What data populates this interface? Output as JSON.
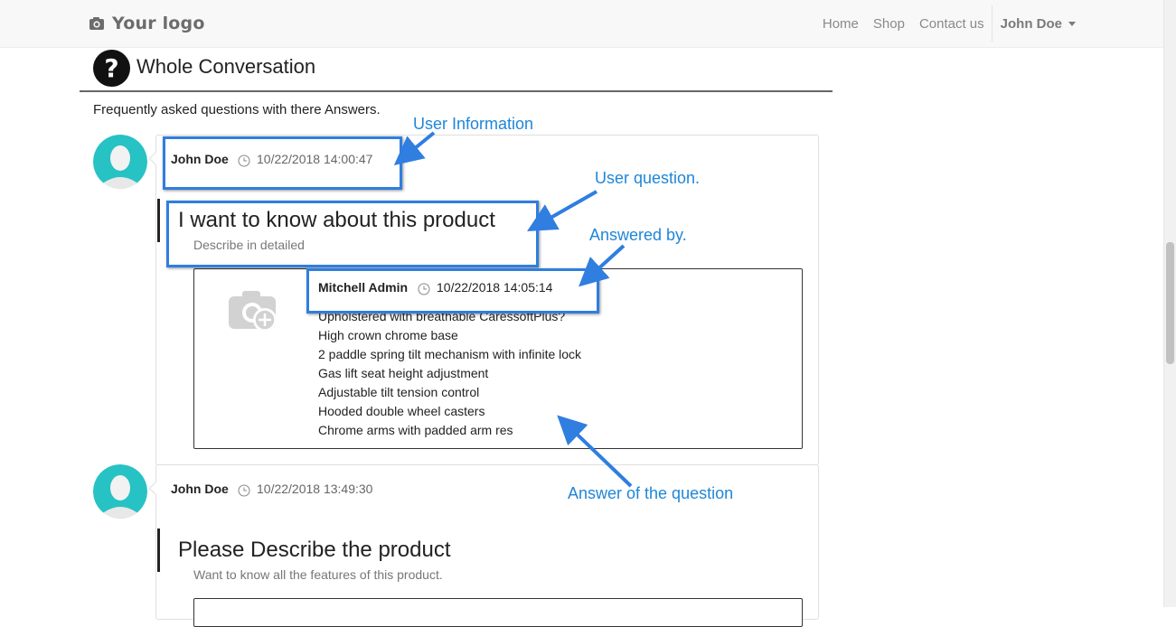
{
  "navbar": {
    "logo_text": "Your logo",
    "links": [
      "Home",
      "Shop",
      "Contact us"
    ],
    "user": "John Doe"
  },
  "header": {
    "title": "Whole Conversation",
    "subtitle": "Frequently asked questions with there Answers."
  },
  "threads": [
    {
      "author": "John Doe",
      "timestamp": "10/22/2018 14:00:47",
      "question": "I want to know about this product",
      "description": "Describe in detailed",
      "answer": {
        "author": "Mitchell Admin",
        "timestamp": "10/22/2018 14:05:14",
        "lines": [
          "Upholstered with breathable CaressoftPlus?",
          "High crown chrome base",
          "2 paddle spring tilt mechanism with infinite lock",
          "Gas lift seat height adjustment",
          "Adjustable tilt tension control",
          "Hooded double wheel casters",
          "Chrome arms with padded arm res"
        ]
      }
    },
    {
      "author": "John Doe",
      "timestamp": "10/22/2018 13:49:30",
      "question": "Please Describe the product",
      "description": "Want to know all the features of this product."
    }
  ],
  "annotations": {
    "user_information": "User Information",
    "user_question": "User question.",
    "answered_by": "Answered by.",
    "answer_of_question": "Answer of the question"
  },
  "colors": {
    "annotation": "#1f86d8",
    "highlight_border": "#2f7ee0",
    "avatar_bg": "#27c2c4",
    "navbar_bg": "#f8f8f8"
  },
  "icons": [
    "camera-icon",
    "question-icon",
    "clock-icon",
    "avatar-icon",
    "camera-plus-icon",
    "caret-down-icon"
  ]
}
